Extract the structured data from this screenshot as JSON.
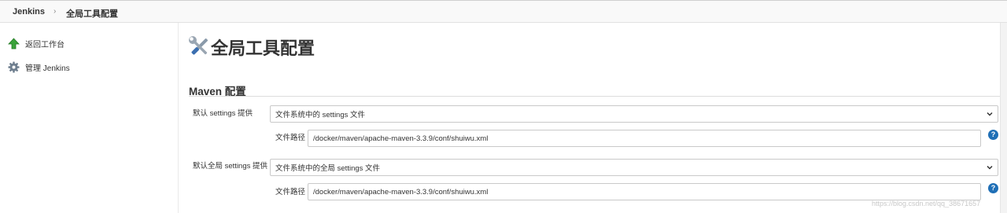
{
  "breadcrumb": {
    "home": "Jenkins",
    "separator": "›",
    "current": "全局工具配置"
  },
  "sidebar": {
    "items": [
      {
        "label": "返回工作台",
        "icon": "green-up-arrow-icon"
      },
      {
        "label": "管理 Jenkins",
        "icon": "gear-icon"
      }
    ]
  },
  "page": {
    "title": "全局工具配置",
    "title_icon": "tools-icon"
  },
  "maven_section": {
    "title": "Maven 配置",
    "default_settings": {
      "label": "默认 settings 提供",
      "selected": "文件系统中的 settings 文件",
      "path_label": "文件路径",
      "path_value": "/docker/maven/apache-maven-3.3.9/conf/shuiwu.xml"
    },
    "default_global_settings": {
      "label": "默认全局 settings 提供",
      "selected": "文件系统中的全局 settings 文件",
      "path_label": "文件路径",
      "path_value": "/docker/maven/apache-maven-3.3.9/conf/shuiwu.xml"
    },
    "help_glyph": "?"
  },
  "watermark": "https://blog.csdn.net/qq_38671657",
  "colors": {
    "help_blue": "#1f6fb6",
    "arrow_green": "#2e9a2e",
    "border": "#c9c9c9"
  }
}
